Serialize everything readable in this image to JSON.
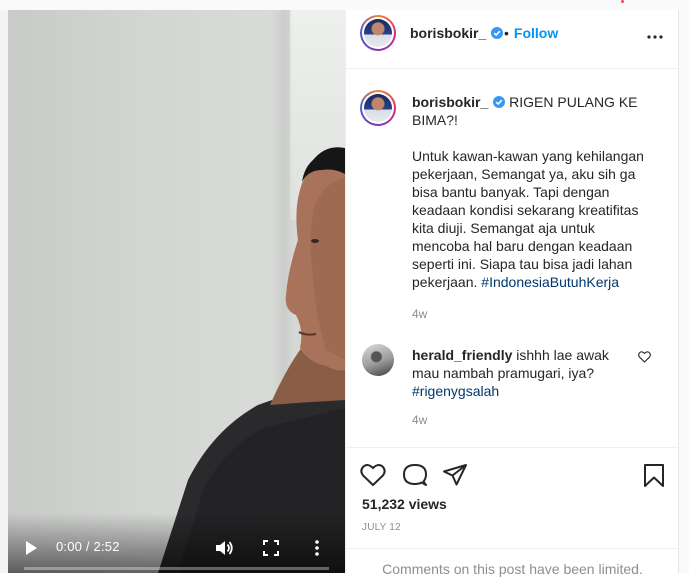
{
  "video": {
    "time": "0:00 / 2:52"
  },
  "post": {
    "username": "borisbokir_",
    "follow_label": "Follow",
    "caption_title": "RIGEN PULANG KE BIMA?!",
    "caption_body": "Untuk kawan-kawan yang kehilangan pekerjaan, Semangat ya, aku sih ga bisa bantu banyak. Tapi dengan keadaan kondisi sekarang kreatifitas kita diuji. Semangat aja untuk mencoba hal baru dengan keadaan seperti ini. Siapa tau bisa jadi lahan pekerjaan.",
    "caption_hashtag": "#IndonesiaButuhKerja",
    "caption_age": "4w"
  },
  "comment": {
    "username": "herald_friendly",
    "text": "ishhh lae awak mau nambah pramugari, iya?",
    "hashtag": "#rigenygsalah",
    "age": "4w"
  },
  "stats": {
    "views": "51,232 views",
    "date": "JULY 12",
    "comments_limited": "Comments on this post have been limited."
  },
  "colors": {
    "link": "#0095f6",
    "hashtag": "#00376b",
    "verified": "#3897f0",
    "muted": "#8e8e8e"
  },
  "icons": [
    "play-icon",
    "volume-icon",
    "fullscreen-icon",
    "more-vertical-icon",
    "verified-icon",
    "more-horizontal-icon",
    "heart-icon",
    "comment-icon",
    "share-icon",
    "bookmark-icon"
  ]
}
